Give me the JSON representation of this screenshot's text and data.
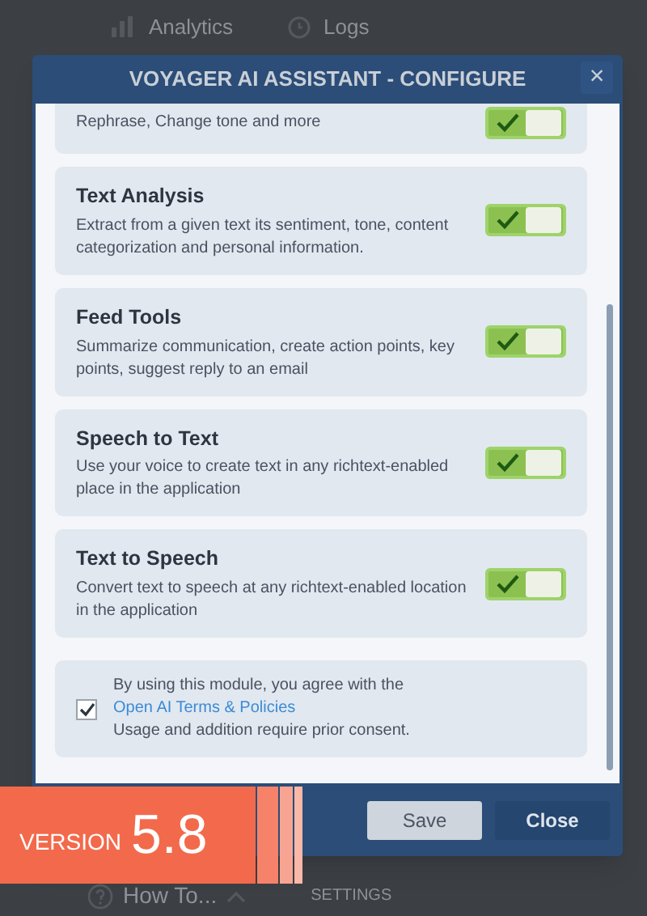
{
  "nav": {
    "items": [
      {
        "label": "Analytics",
        "kind": "chart"
      },
      {
        "label": "Logs",
        "kind": "clock"
      }
    ]
  },
  "dialog": {
    "title": "VOYAGER AI ASSISTANT - CONFIGURE",
    "close": "×",
    "features": [
      {
        "description": "Rephrase, Change tone and more",
        "on": true
      },
      {
        "title": "Text Analysis",
        "description": "Extract from a given text its sentiment, tone, content categorization and personal information.",
        "on": true
      },
      {
        "title": "Feed Tools",
        "description": "Summarize communication, create action points, key points, suggest reply to an email",
        "on": true
      },
      {
        "title": "Speech to Text",
        "description": "Use your voice to create text in any richtext-enabled place in the application",
        "on": true
      },
      {
        "title": "Text to Speech",
        "description": "Convert text to speech at any richtext-enabled location in the application",
        "on": true
      }
    ],
    "consent": {
      "checked": true,
      "text": "By using this module, you agree with the ",
      "link": "Open AI Terms & Policies",
      "note": "Usage and addition require prior consent."
    },
    "buttons": [
      {
        "label": "Save",
        "kind": "secondary"
      },
      {
        "label": "Close",
        "kind": "primary"
      }
    ]
  },
  "badge": {
    "prefix": "VERSION",
    "version": "5.8"
  },
  "bottom": {
    "help": "How To...",
    "section": "SETTINGS"
  }
}
